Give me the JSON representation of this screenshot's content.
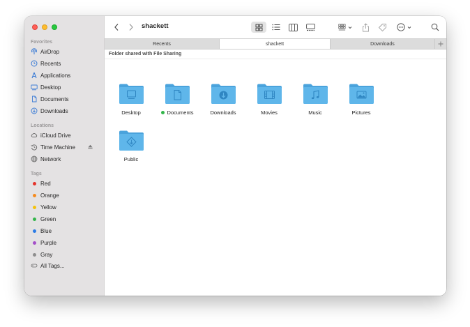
{
  "window": {
    "title": "shackett"
  },
  "sidebar": {
    "favorites_header": "Favorites",
    "favorites": [
      {
        "label": "AirDrop",
        "icon": "airdrop-icon"
      },
      {
        "label": "Recents",
        "icon": "clock-icon"
      },
      {
        "label": "Applications",
        "icon": "applications-icon"
      },
      {
        "label": "Desktop",
        "icon": "desktop-icon"
      },
      {
        "label": "Documents",
        "icon": "document-icon"
      },
      {
        "label": "Downloads",
        "icon": "download-icon"
      }
    ],
    "locations_header": "Locations",
    "locations": [
      {
        "label": "iCloud Drive",
        "icon": "cloud-icon"
      },
      {
        "label": "Time Machine",
        "icon": "time-machine-icon"
      },
      {
        "label": "Network",
        "icon": "network-icon"
      }
    ],
    "tags_header": "Tags",
    "tags": [
      {
        "label": "Red",
        "color": "#e5342b"
      },
      {
        "label": "Orange",
        "color": "#f58b1f"
      },
      {
        "label": "Yellow",
        "color": "#f4c20d"
      },
      {
        "label": "Green",
        "color": "#33b54a"
      },
      {
        "label": "Blue",
        "color": "#2c7be5"
      },
      {
        "label": "Purple",
        "color": "#a44fc9"
      },
      {
        "label": "Gray",
        "color": "#8e8e8e"
      }
    ],
    "all_tags": "All Tags..."
  },
  "tabs": [
    {
      "label": "Recents",
      "active": false
    },
    {
      "label": "shackett",
      "active": true
    },
    {
      "label": "Downloads",
      "active": false
    }
  ],
  "content": {
    "shared_banner": "Folder shared with File Sharing",
    "folders": [
      {
        "label": "Desktop",
        "icon": "desktop-folder-icon"
      },
      {
        "label": "Documents",
        "icon": "documents-folder-icon",
        "tag_color": "#33b54a"
      },
      {
        "label": "Downloads",
        "icon": "downloads-folder-icon"
      },
      {
        "label": "Movies",
        "icon": "movies-folder-icon"
      },
      {
        "label": "Music",
        "icon": "music-folder-icon"
      },
      {
        "label": "Pictures",
        "icon": "pictures-folder-icon"
      },
      {
        "label": "Public",
        "icon": "public-folder-icon"
      }
    ]
  },
  "colors": {
    "accent": "#2c7be5",
    "folder_front": "#5fb6ea",
    "folder_back": "#4aa3dc"
  }
}
